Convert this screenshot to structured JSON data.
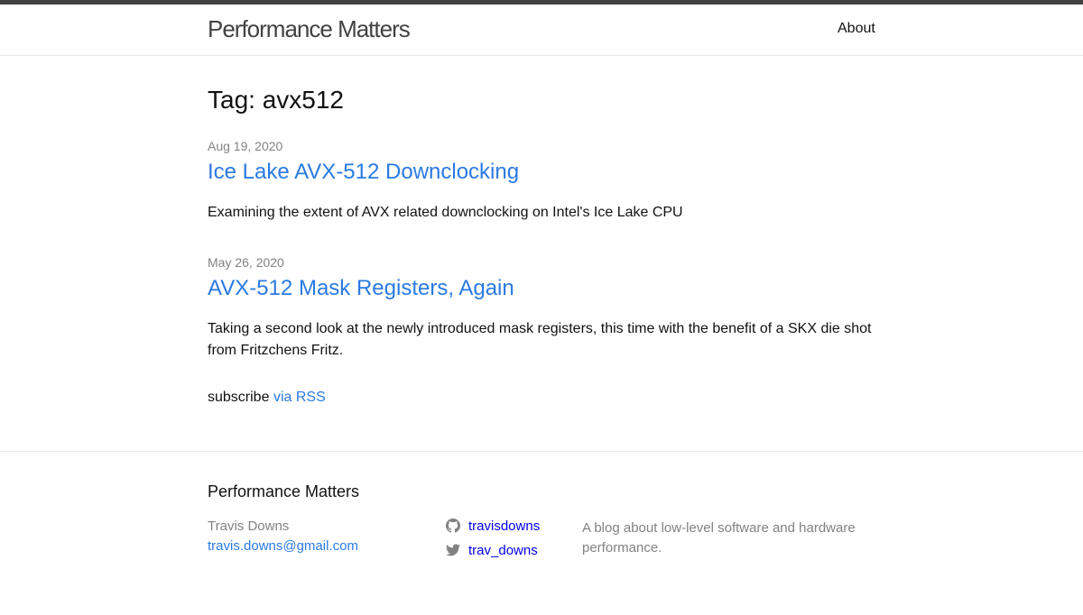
{
  "header": {
    "site_title": "Performance Matters",
    "nav": {
      "about_label": "About"
    }
  },
  "page": {
    "heading": "Tag: avx512"
  },
  "posts": [
    {
      "date": "Aug 19, 2020",
      "title": "Ice Lake AVX-512 Downclocking",
      "excerpt": "Examining the extent of AVX related downclocking on Intel's Ice Lake CPU"
    },
    {
      "date": "May 26, 2020",
      "title": "AVX-512 Mask Registers, Again",
      "excerpt": "Taking a second look at the newly introduced mask registers, this time with the benefit of a SKX die shot from Fritzchens Fritz."
    }
  ],
  "subscribe": {
    "prefix": "subscribe",
    "link_label": "via RSS"
  },
  "footer": {
    "heading": "Performance Matters",
    "author_name": "Travis Downs",
    "email": "travis.downs@gmail.com",
    "github": {
      "icon": "github-icon",
      "username": "travisdowns"
    },
    "twitter": {
      "icon": "twitter-icon",
      "username": "trav_downs"
    },
    "description": "A blog about low-level software and hardware performance."
  },
  "colors": {
    "link": "#2a7ae2",
    "muted": "#828282",
    "topbar": "#424242"
  }
}
